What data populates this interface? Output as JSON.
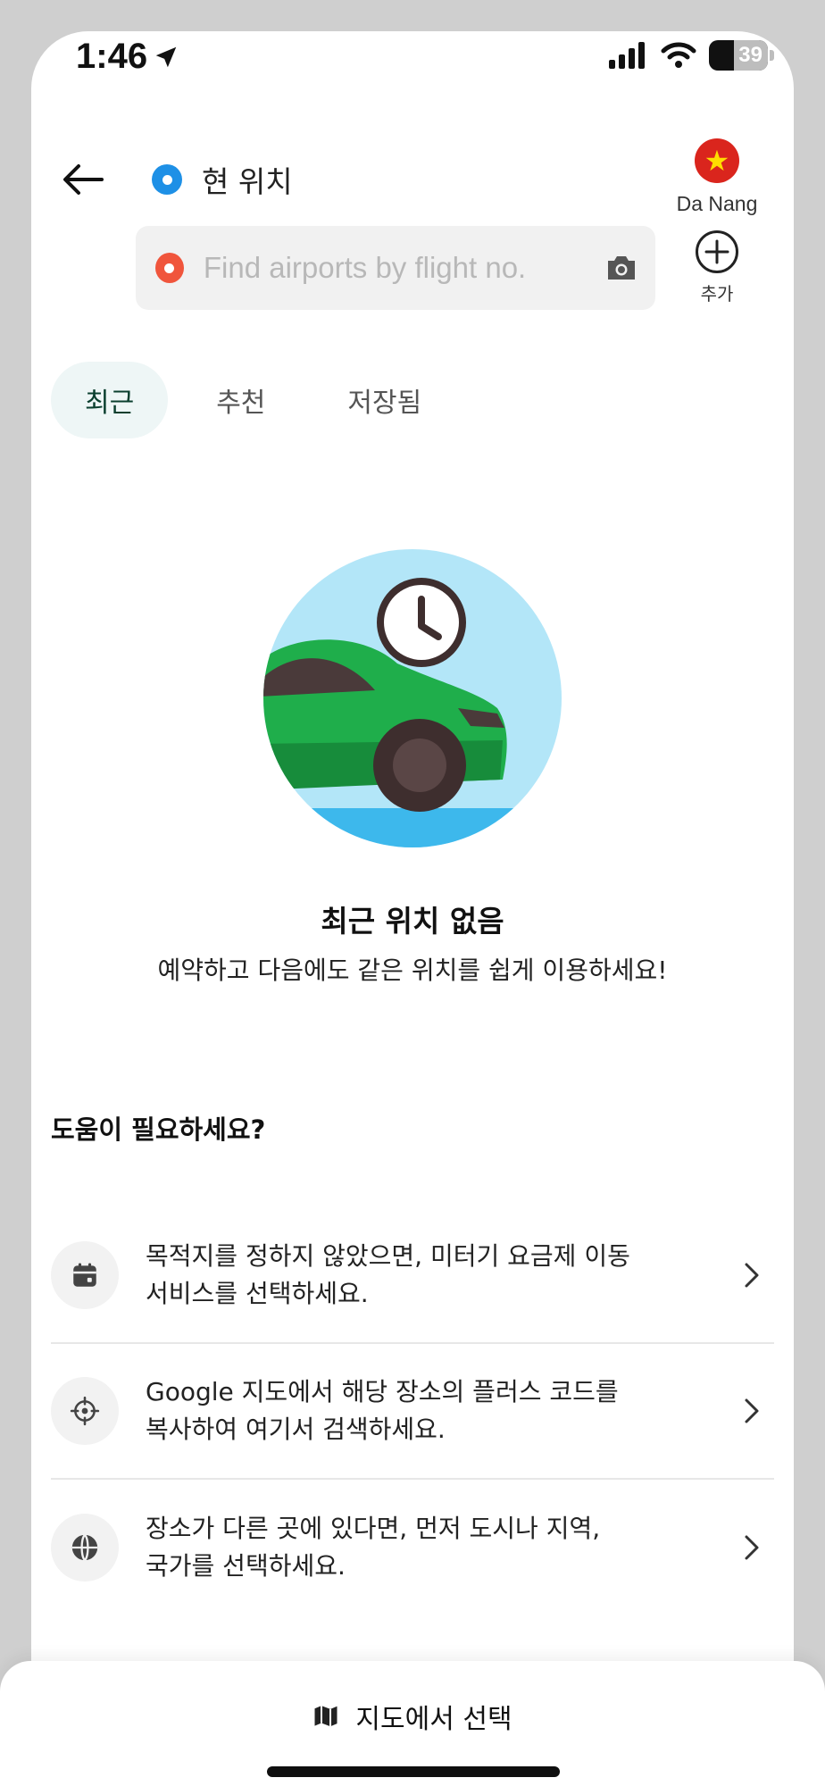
{
  "status_bar": {
    "time": "1:46",
    "battery": "39"
  },
  "header": {
    "origin_label": "현 위치",
    "search_placeholder": "Find airports by flight no.",
    "city_name": "Da Nang",
    "add_label": "추가"
  },
  "tabs": [
    {
      "label": "최근",
      "active": true
    },
    {
      "label": "추천",
      "active": false
    },
    {
      "label": "저장됨",
      "active": false
    }
  ],
  "empty_state": {
    "title": "최근 위치 없음",
    "subtitle": "예약하고 다음에도 같은 위치를 쉽게 이용하세요!"
  },
  "help": {
    "title": "도움이 필요하세요?",
    "items": [
      {
        "icon": "calendar-icon",
        "line1": "목적지를 정하지 않았으면, 미터기 요금제 이동",
        "line2": "서비스를 선택하세요."
      },
      {
        "icon": "crosshair-icon",
        "line1": "Google 지도에서 해당 장소의 플러스 코드를",
        "line2": "복사하여 여기서 검색하세요."
      },
      {
        "icon": "globe-icon",
        "line1": "장소가 다른 곳에 있다면, 먼저 도시나 지역,",
        "line2": "국가를 선택하세요."
      }
    ]
  },
  "bottom": {
    "map_select_label": "지도에서 선택"
  },
  "colors": {
    "accent_green": "#0a3f2e",
    "origin_dot": "#1e90e6",
    "destination_dot": "#f0553c",
    "car_green": "#1fae4b"
  }
}
